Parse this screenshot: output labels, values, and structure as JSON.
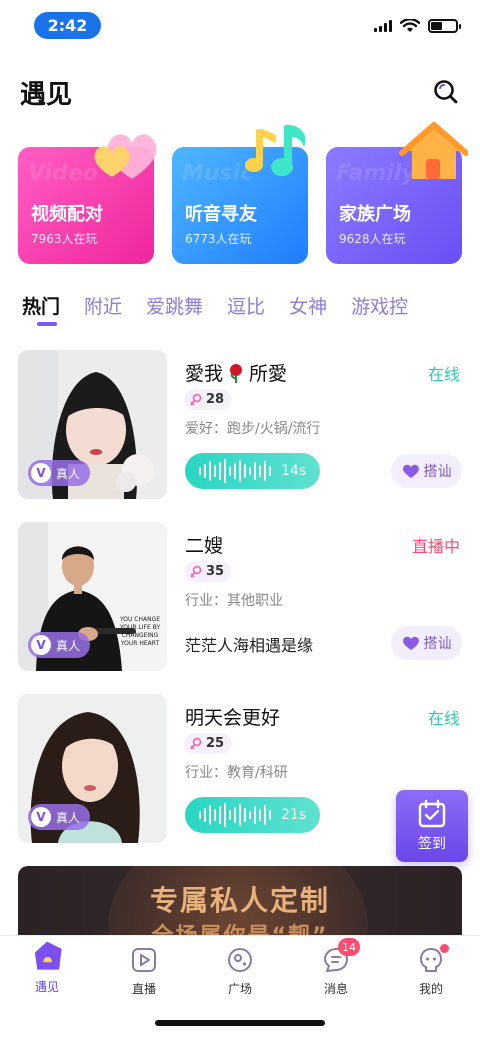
{
  "status_bar": {
    "time": "2:42",
    "battery_level": 0.45
  },
  "header": {
    "title": "遇见"
  },
  "features": [
    {
      "title": "视频配对",
      "subtitle": "7963人在玩",
      "watermark": "Video",
      "color": "#f0269c",
      "icon": "hearts-icon"
    },
    {
      "title": "听音寻友",
      "subtitle": "6773人在玩",
      "watermark": "Music",
      "color": "#1f7dff",
      "icon": "music-note-icon"
    },
    {
      "title": "家族广场",
      "subtitle": "9628人在玩",
      "watermark": "Family",
      "color": "#6a4ff5",
      "icon": "house-icon"
    }
  ],
  "tabs": [
    "热门",
    "附近",
    "爱跳舞",
    "逗比",
    "女神",
    "游戏控"
  ],
  "active_tab": "热门",
  "users": [
    {
      "name": "愛我",
      "name_suffix": "所愛",
      "has_rose": true,
      "status": "在线",
      "age": "28",
      "detail": "爱好：跑步/火锅/流行",
      "voice_duration": "14s",
      "verified": "真人",
      "chat_label": "搭讪"
    },
    {
      "name": "二嫂",
      "name_suffix": "",
      "has_rose": false,
      "status": "直播中",
      "age": "35",
      "detail": "行业：其他职业",
      "motto": "茫茫人海相遇是缘",
      "verified": "真人",
      "chat_label": "搭讪",
      "photo_text": "YOU CHANGE YOUR LIFE BY CHANGEING YOUR HEART"
    },
    {
      "name": "明天会更好",
      "name_suffix": "",
      "has_rose": false,
      "status": "在线",
      "age": "25",
      "detail": "行业：教育/科研",
      "voice_duration": "21s",
      "verified": "真人",
      "chat_label": "搭讪"
    }
  ],
  "signin": {
    "label": "签到"
  },
  "banner": {
    "title": "专属私人定制",
    "subtitle": "全场属你是“靓”"
  },
  "tabbar": [
    {
      "label": "遇见",
      "icon": "home-icon",
      "active": true
    },
    {
      "label": "直播",
      "icon": "play-icon"
    },
    {
      "label": "广场",
      "icon": "planet-icon"
    },
    {
      "label": "消息",
      "icon": "message-icon",
      "badge": "14"
    },
    {
      "label": "我的",
      "icon": "profile-icon",
      "dot": true
    }
  ],
  "colors": {
    "accent": "#6a46ea",
    "online": "#30c9b4",
    "live": "#ff4b6e",
    "tab_inactive": "#8c7fd6"
  }
}
